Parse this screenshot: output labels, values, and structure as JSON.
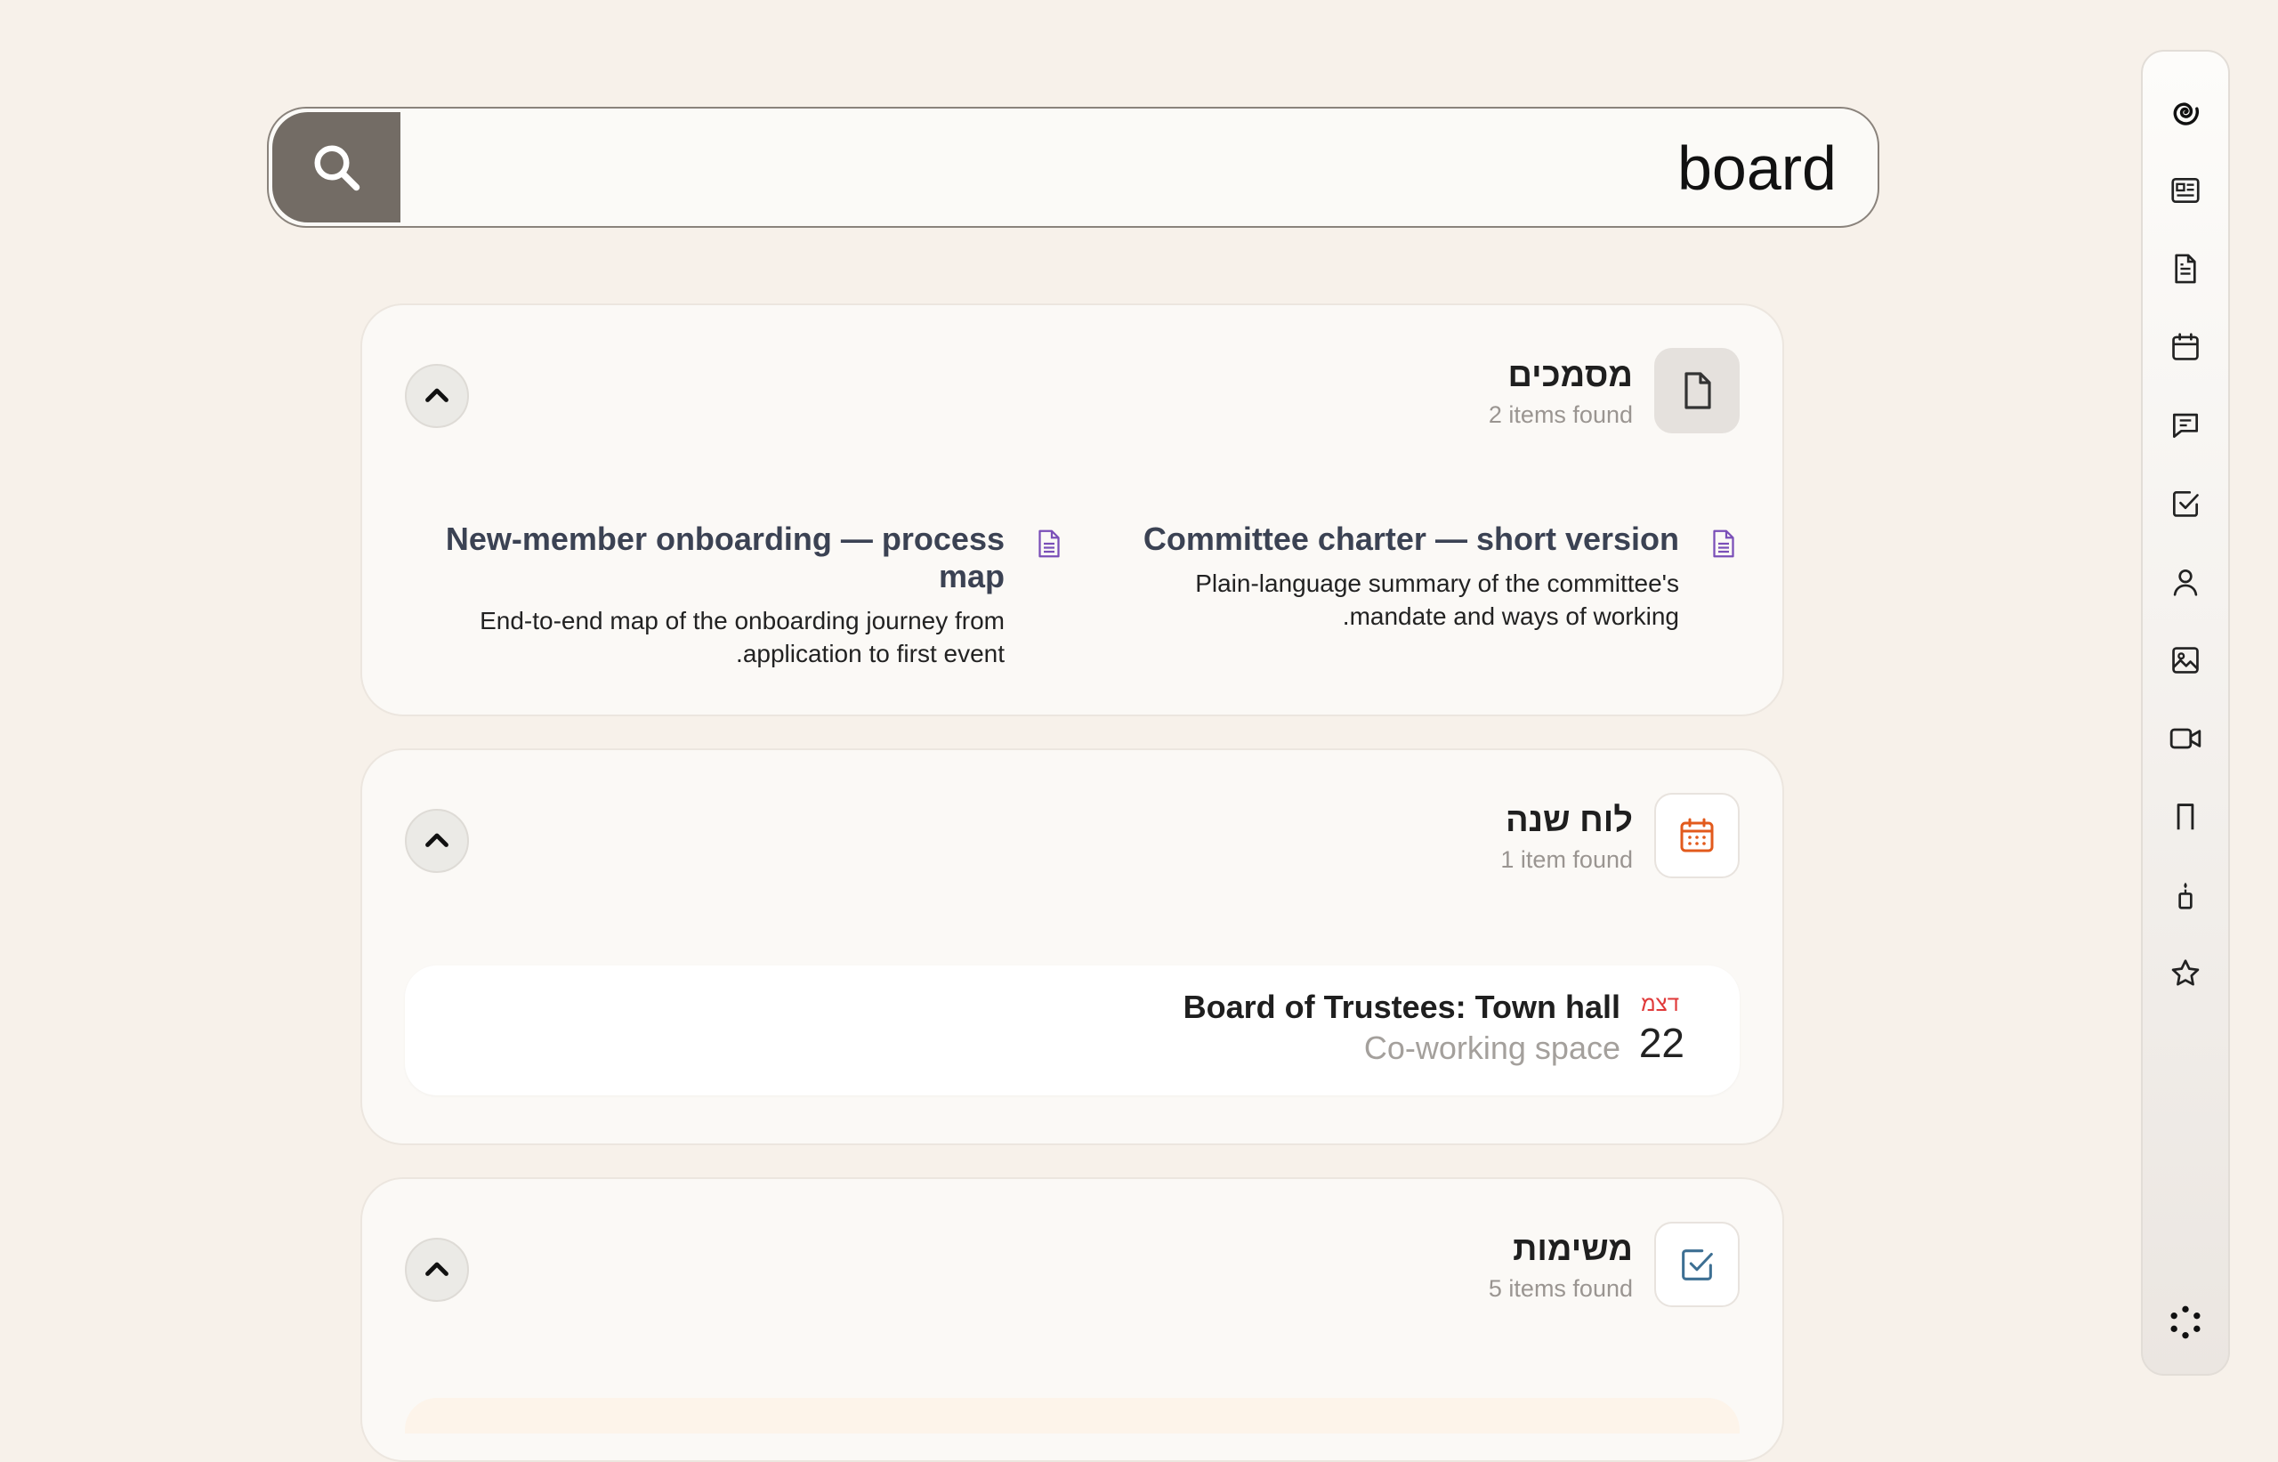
{
  "search": {
    "query": "board",
    "button_icon": "search-icon"
  },
  "sections": {
    "documents": {
      "title": "מסמכים",
      "count": "2 items found",
      "icon": "document-icon",
      "results": [
        {
          "title": "Committee charter — short version",
          "description": "Plain-language summary of the committee's mandate and ways of working.",
          "icon": "document-lines-icon"
        },
        {
          "title": "New-member onboarding — process map",
          "description": "End-to-end map of the onboarding journey from application to first event.",
          "icon": "document-lines-icon"
        }
      ]
    },
    "calendar": {
      "title": "לוח שנה",
      "count": "1 item found",
      "icon": "calendar-icon",
      "events": [
        {
          "month": "דצמ",
          "day": "22",
          "title": "Board of Trustees: Town hall",
          "location": "Co-working space"
        }
      ]
    },
    "tasks": {
      "title": "משימות",
      "count": "5 items found",
      "icon": "checkbox-icon"
    }
  },
  "colors": {
    "background": "#f7f1ea",
    "search_button": "#736c65",
    "doc_icon": "#7a4fb8",
    "calendar_accent": "#e25a1c",
    "task_accent": "#3d6f93",
    "month_label": "#e03a3a"
  },
  "rail": {
    "items": [
      "spiral-logo-icon",
      "newspaper-icon",
      "document-icon",
      "calendar-icon",
      "chat-icon",
      "checkbox-icon",
      "person-icon",
      "image-icon",
      "video-icon",
      "bookmark-icon",
      "candle-icon",
      "star-icon",
      "dots-grid-icon"
    ]
  }
}
